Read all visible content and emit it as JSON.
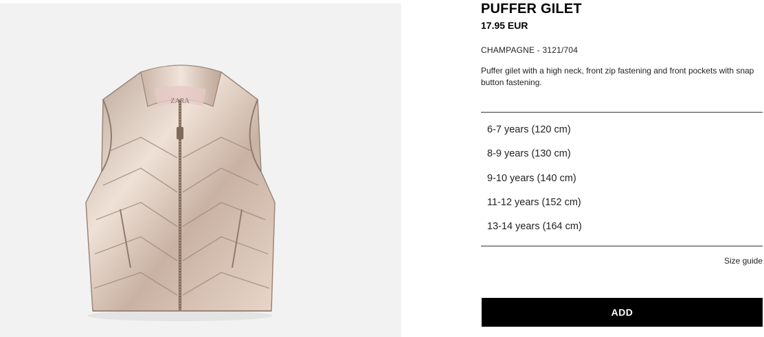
{
  "product": {
    "name": "PUFFER GILET",
    "price": "17.95 EUR",
    "color_ref": "CHAMPAGNE - 3121/704",
    "description": "Puffer gilet with a high neck, front zip fastening and front pockets with snap button fastening.",
    "image_label": "ZARA",
    "image_icon": "puffer-gilet-image"
  },
  "sizes": [
    {
      "label": "6-7 years (120 cm)"
    },
    {
      "label": "8-9 years (130 cm)"
    },
    {
      "label": "9-10 years (140 cm)"
    },
    {
      "label": "11-12 years (152 cm)"
    },
    {
      "label": "13-14 years (164 cm)"
    }
  ],
  "size_guide_label": "Size guide",
  "add_button_label": "ADD",
  "colors": {
    "image_background": "#f2f2f2",
    "button_background": "#000000",
    "button_text": "#ffffff",
    "garment": "#d9c3b3"
  }
}
